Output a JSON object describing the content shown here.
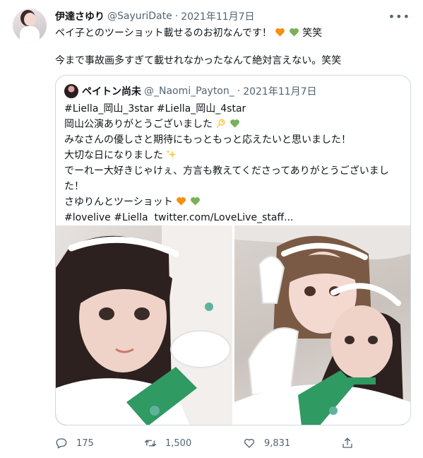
{
  "author": {
    "name": "伊達さゆり",
    "handle": "@SayuriDate",
    "dot": "·",
    "date": "2021年11月7日"
  },
  "tweet_lines": {
    "line1": "ペイ子とのツーショット載せるのお初なんです！",
    "line1_tail": "笑笑",
    "line2": "今まで事故画多すぎて載せれなかったなんて絶対言えない。笑笑"
  },
  "quote": {
    "name": "ペイトン尚未",
    "handle": "@_Naomi_Payton_",
    "dot": "·",
    "date": "2021年11月7日",
    "lines": {
      "l1": "#Liella_岡山_3star #Liella_岡山_4star",
      "l2": "岡山公演ありがとうございました",
      "l3": "みなさんの優しさと期待にもっともっと応えたいと思いました！",
      "l4": "大切な日になりました",
      "l5": "でーれー大好きじゃけぇ、方言も教えてくださってありがとうございました！",
      "l6": "さゆりんとツーショット",
      "l7_tags": "#lovelive #Liella",
      "l7_link": "twitter.com/LoveLive_staff..."
    }
  },
  "actions": {
    "replies": "175",
    "retweets": "1,500",
    "likes": "9,831"
  },
  "icons": [
    "more-icon",
    "reply-icon",
    "retweet-icon",
    "like-icon",
    "share-icon",
    "orange-heart-icon",
    "green-heart-icon",
    "dizzy-icon",
    "sparkles-icon"
  ],
  "colors": {
    "text": "#0f1419",
    "secondary": "#536471",
    "border": "#cfd9de",
    "orange_heart": "#f4900c",
    "green_heart": "#78b159"
  }
}
